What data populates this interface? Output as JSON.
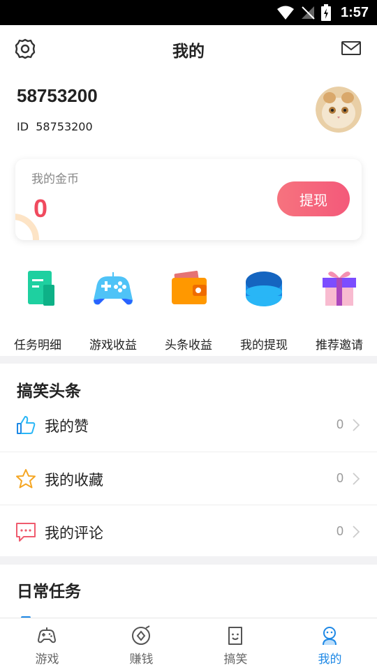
{
  "status_bar": {
    "time": "1:57"
  },
  "header": {
    "title": "我的"
  },
  "profile": {
    "username": "58753200",
    "id_label": "ID",
    "id_value": "58753200"
  },
  "coins": {
    "label": "我的金币",
    "value": "0",
    "withdraw_label": "提现"
  },
  "shortcuts": [
    {
      "label": "任务明细",
      "icon": "task-detail-icon"
    },
    {
      "label": "游戏收益",
      "icon": "gamepad-icon"
    },
    {
      "label": "头条收益",
      "icon": "wallet-icon"
    },
    {
      "label": "我的提现",
      "icon": "withdraw-icon"
    },
    {
      "label": "推荐邀请",
      "icon": "gift-icon"
    }
  ],
  "funny_section": {
    "title": "搞笑头条",
    "items": [
      {
        "label": "我的赞",
        "count": "0",
        "icon": "thumbs-up-icon"
      },
      {
        "label": "我的收藏",
        "count": "0",
        "icon": "star-icon"
      },
      {
        "label": "我的评论",
        "count": "0",
        "icon": "comment-icon"
      }
    ]
  },
  "daily_section": {
    "title": "日常任务"
  },
  "tabbar": {
    "tabs": [
      {
        "label": "游戏",
        "icon": "gamepad-icon",
        "active": false
      },
      {
        "label": "赚钱",
        "icon": "money-icon",
        "active": false
      },
      {
        "label": "搞笑",
        "icon": "funny-face-icon",
        "active": false
      },
      {
        "label": "我的",
        "icon": "profile-icon",
        "active": true
      }
    ]
  },
  "colors": {
    "accent": "#1e88e5",
    "coin_value": "#f04a5e",
    "withdraw_button": "#f4657c"
  }
}
